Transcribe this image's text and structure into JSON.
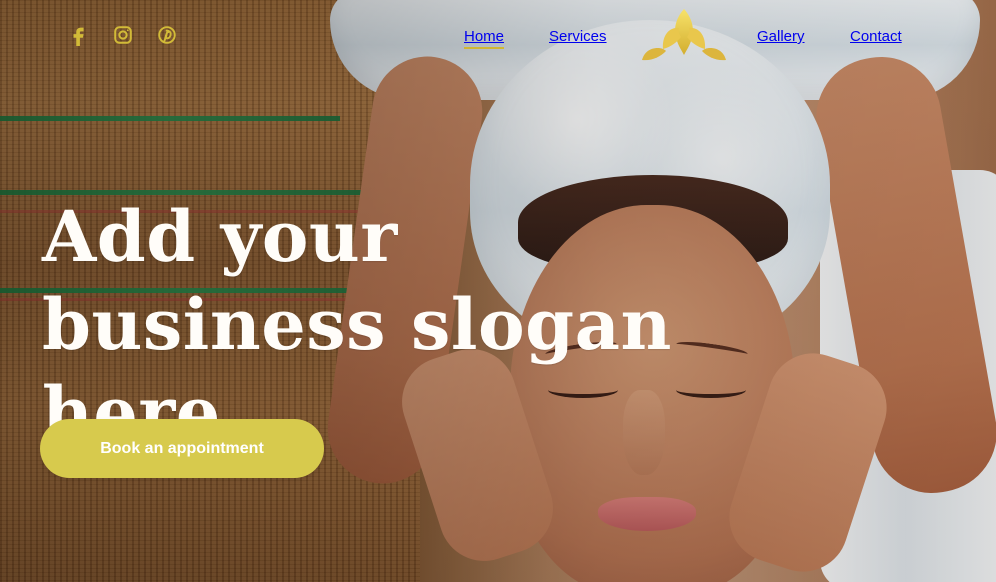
{
  "header": {
    "social_icons": [
      "facebook-icon",
      "instagram-icon",
      "pinterest-icon"
    ],
    "nav_items": [
      {
        "label": "Home",
        "active": true
      },
      {
        "label": "Services",
        "active": false
      },
      {
        "label": "Gallery",
        "active": false
      },
      {
        "label": "Contact",
        "active": false
      }
    ]
  },
  "hero": {
    "title": "Add your business slogan here",
    "cta_label": "Book an appointment"
  },
  "colors": {
    "accent": "#D7CA4D",
    "social_icon": "#D2BB38",
    "nav_text": "#F4F1EB",
    "hero_text": "#FFFDF9"
  },
  "icons": {
    "logo": "lotus-logo-icon"
  }
}
